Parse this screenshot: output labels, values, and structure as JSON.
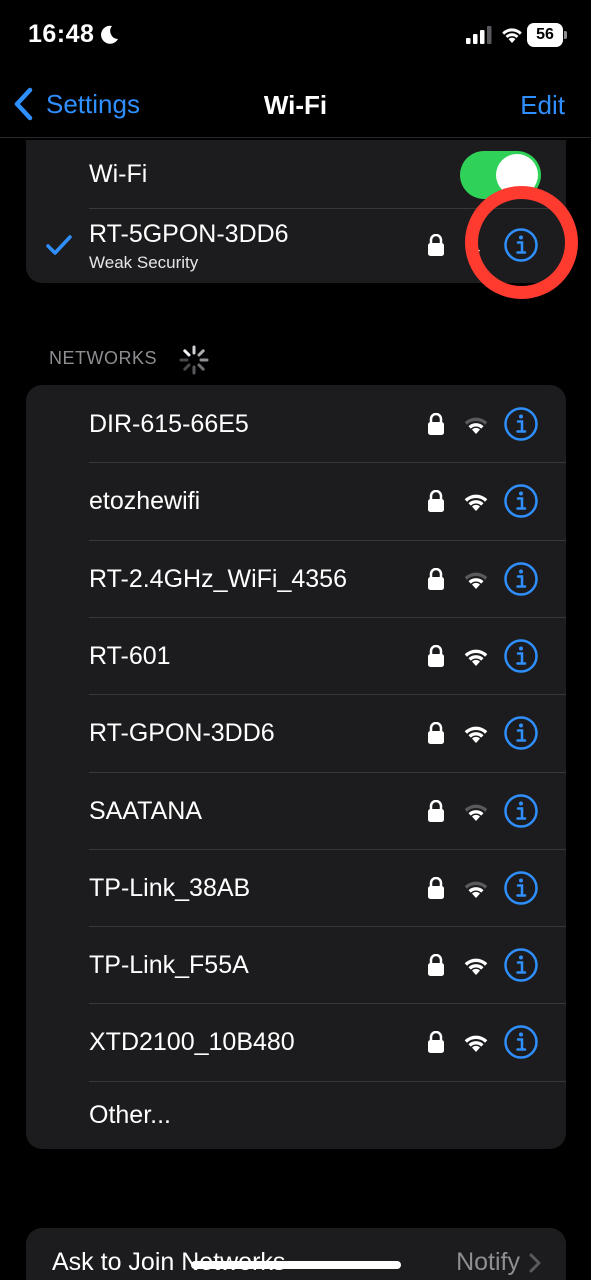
{
  "status_bar": {
    "time": "16:48",
    "battery": "56",
    "icons": [
      "moon-icon",
      "cellular-signal-icon",
      "wifi-icon",
      "battery-icon"
    ]
  },
  "nav": {
    "back_label": "Settings",
    "title": "Wi-Fi",
    "edit_label": "Edit"
  },
  "wifi": {
    "toggle_label": "Wi-Fi",
    "toggle_on": true,
    "connected": {
      "name": "RT-5GPON-3DD6",
      "subtitle": "Weak Security"
    }
  },
  "networks": {
    "header": "NETWORKS",
    "items": [
      {
        "name": "DIR-615-66E5",
        "signal": 0.67
      },
      {
        "name": "etozhewifi",
        "signal": 1.0
      },
      {
        "name": "RT-2.4GHz_WiFi_4356",
        "signal": 0.67
      },
      {
        "name": "RT-601",
        "signal": 1.0
      },
      {
        "name": "RT-GPON-3DD6",
        "signal": 1.0
      },
      {
        "name": "SAATANA",
        "signal": 0.67
      },
      {
        "name": "TP-Link_38AB",
        "signal": 0.67
      },
      {
        "name": "TP-Link_F55A",
        "signal": 1.0
      },
      {
        "name": "XTD2100_10B480",
        "signal": 1.0
      }
    ],
    "other_label": "Other..."
  },
  "ask_to_join": {
    "label": "Ask to Join Networks",
    "value": "Notify"
  },
  "colors": {
    "accent": "#2f8fff",
    "toggle_on": "#30d158",
    "highlight": "#ff3b30",
    "card": "#1c1c1e",
    "background": "#000000"
  }
}
